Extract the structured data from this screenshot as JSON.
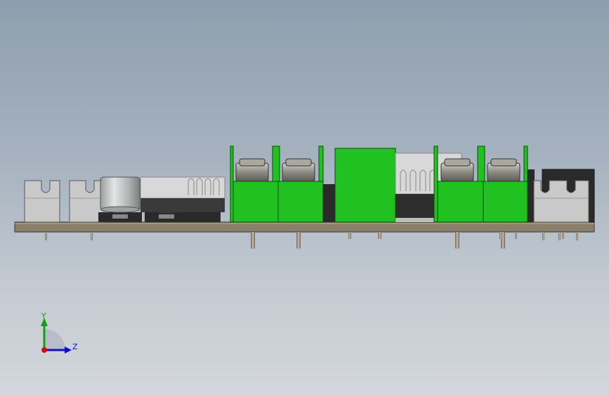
{
  "viewport": {
    "view": "side",
    "colors": {
      "background_top": "#8e9eae",
      "background_bottom": "#d3d7dc",
      "pcb": "#8a7f6a",
      "green_housing": "#22c122",
      "capacitor": "#b8bcbc",
      "connector": "#c9c9c9",
      "heatsink": "#d8d8d8",
      "dark_part": "#2a2a2a"
    }
  },
  "triad": {
    "y_label": "Y",
    "z_label": "Z",
    "x_color": "#d01010",
    "y_color": "#10a010",
    "z_color": "#1010c0"
  }
}
